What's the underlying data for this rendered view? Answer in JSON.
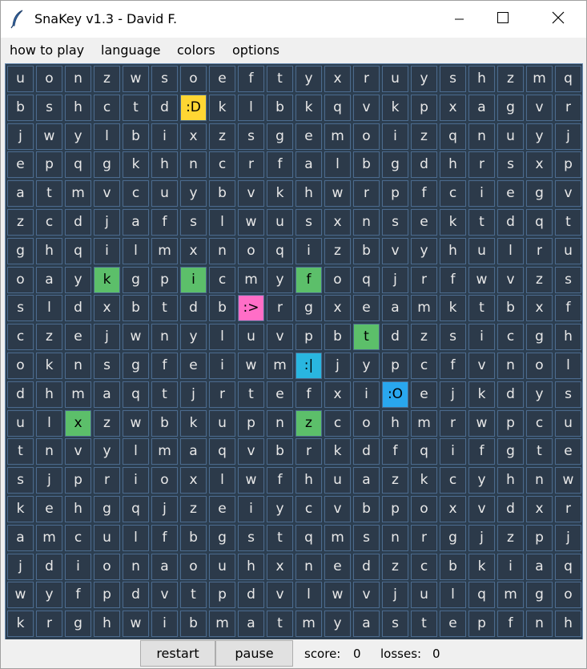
{
  "window": {
    "title": "SnaKey v1.3 - David F."
  },
  "menu": {
    "items": [
      "how to play",
      "language",
      "colors",
      "options"
    ]
  },
  "board": {
    "rows": [
      [
        "u",
        "o",
        "n",
        "z",
        "w",
        "s",
        "o",
        "e",
        "f",
        "t",
        "y",
        "x",
        "r",
        "u",
        "y",
        "s",
        "h",
        "z",
        "m",
        "q"
      ],
      [
        "b",
        "s",
        "h",
        "c",
        "t",
        "d",
        ":D",
        "k",
        "l",
        "b",
        "k",
        "q",
        "v",
        "k",
        "p",
        "x",
        "a",
        "g",
        "v",
        "r"
      ],
      [
        "j",
        "w",
        "y",
        "l",
        "b",
        "i",
        "x",
        "z",
        "s",
        "g",
        "e",
        "m",
        "o",
        "i",
        "z",
        "q",
        "n",
        "u",
        "y",
        "j"
      ],
      [
        "e",
        "p",
        "q",
        "g",
        "k",
        "h",
        "n",
        "c",
        "r",
        "f",
        "a",
        "l",
        "b",
        "g",
        "d",
        "h",
        "r",
        "s",
        "x",
        "p"
      ],
      [
        "a",
        "t",
        "m",
        "v",
        "c",
        "u",
        "y",
        "b",
        "v",
        "k",
        "h",
        "w",
        "r",
        "p",
        "f",
        "c",
        "i",
        "e",
        "g",
        "v"
      ],
      [
        "z",
        "c",
        "d",
        "j",
        "a",
        "f",
        "s",
        "l",
        "w",
        "u",
        "s",
        "x",
        "n",
        "s",
        "e",
        "k",
        "t",
        "d",
        "q",
        "t"
      ],
      [
        "g",
        "h",
        "q",
        "i",
        "l",
        "m",
        "x",
        "n",
        "o",
        "q",
        "i",
        "z",
        "b",
        "v",
        "y",
        "h",
        "u",
        "l",
        "r",
        "u"
      ],
      [
        "o",
        "a",
        "y",
        "k",
        "g",
        "p",
        "i",
        "c",
        "m",
        "y",
        "f",
        "o",
        "q",
        "j",
        "r",
        "f",
        "w",
        "v",
        "z",
        "s"
      ],
      [
        "s",
        "l",
        "d",
        "x",
        "b",
        "t",
        "d",
        "b",
        ":>",
        "r",
        "g",
        "x",
        "e",
        "a",
        "m",
        "k",
        "t",
        "b",
        "x",
        "f"
      ],
      [
        "c",
        "z",
        "e",
        "j",
        "w",
        "n",
        "y",
        "l",
        "u",
        "v",
        "p",
        "b",
        "t",
        "d",
        "z",
        "s",
        "i",
        "c",
        "g",
        "h"
      ],
      [
        "o",
        "k",
        "n",
        "s",
        "g",
        "f",
        "e",
        "i",
        "w",
        "m",
        ":|",
        "j",
        "y",
        "p",
        "c",
        "f",
        "v",
        "n",
        "o",
        "l"
      ],
      [
        "d",
        "h",
        "m",
        "a",
        "q",
        "t",
        "j",
        "r",
        "t",
        "e",
        "f",
        "x",
        "i",
        ":O",
        "e",
        "j",
        "k",
        "d",
        "y",
        "s"
      ],
      [
        "u",
        "l",
        "x",
        "z",
        "w",
        "b",
        "k",
        "u",
        "p",
        "n",
        "z",
        "c",
        "o",
        "h",
        "m",
        "r",
        "w",
        "p",
        "c",
        "u"
      ],
      [
        "t",
        "n",
        "v",
        "y",
        "l",
        "m",
        "a",
        "q",
        "v",
        "b",
        "r",
        "k",
        "d",
        "f",
        "q",
        "i",
        "f",
        "g",
        "t",
        "e"
      ],
      [
        "s",
        "j",
        "p",
        "r",
        "i",
        "o",
        "x",
        "l",
        "w",
        "f",
        "h",
        "u",
        "a",
        "z",
        "k",
        "c",
        "y",
        "h",
        "n",
        "w"
      ],
      [
        "k",
        "e",
        "h",
        "g",
        "q",
        "j",
        "z",
        "e",
        "i",
        "y",
        "c",
        "v",
        "b",
        "p",
        "o",
        "x",
        "v",
        "d",
        "x",
        "r"
      ],
      [
        "a",
        "m",
        "c",
        "u",
        "l",
        "f",
        "b",
        "g",
        "s",
        "t",
        "q",
        "m",
        "s",
        "n",
        "r",
        "g",
        "j",
        "z",
        "p",
        "j"
      ],
      [
        "j",
        "d",
        "i",
        "o",
        "n",
        "a",
        "o",
        "u",
        "h",
        "x",
        "n",
        "e",
        "d",
        "z",
        "c",
        "b",
        "k",
        "i",
        "a",
        "q"
      ],
      [
        "w",
        "y",
        "f",
        "p",
        "d",
        "v",
        "t",
        "p",
        "d",
        "v",
        "l",
        "w",
        "v",
        "j",
        "u",
        "l",
        "q",
        "m",
        "g",
        "o"
      ],
      [
        "k",
        "r",
        "g",
        "h",
        "w",
        "i",
        "b",
        "m",
        "a",
        "t",
        "m",
        "y",
        "a",
        "s",
        "t",
        "e",
        "p",
        "f",
        "n",
        "h"
      ]
    ],
    "highlights": [
      {
        "row": 1,
        "col": 6,
        "color": "#ffd633",
        "role": "player"
      },
      {
        "row": 7,
        "col": 3,
        "color": "#5cbf6a",
        "role": "target"
      },
      {
        "row": 7,
        "col": 6,
        "color": "#5cbf6a",
        "role": "target"
      },
      {
        "row": 7,
        "col": 10,
        "color": "#5cbf6a",
        "role": "target"
      },
      {
        "row": 8,
        "col": 8,
        "color": "#ff6ec7",
        "role": "enemy"
      },
      {
        "row": 9,
        "col": 12,
        "color": "#5cbf6a",
        "role": "target"
      },
      {
        "row": 10,
        "col": 10,
        "color": "#29b6e0",
        "role": "enemy"
      },
      {
        "row": 11,
        "col": 13,
        "color": "#29a7ee",
        "role": "enemy"
      },
      {
        "row": 12,
        "col": 2,
        "color": "#5cbf6a",
        "role": "target"
      },
      {
        "row": 12,
        "col": 10,
        "color": "#5cbf6a",
        "role": "target"
      }
    ]
  },
  "controls": {
    "restart_label": "restart",
    "pause_label": "pause",
    "score_label": "score:",
    "score_value": "0",
    "losses_label": "losses:",
    "losses_value": "0"
  }
}
